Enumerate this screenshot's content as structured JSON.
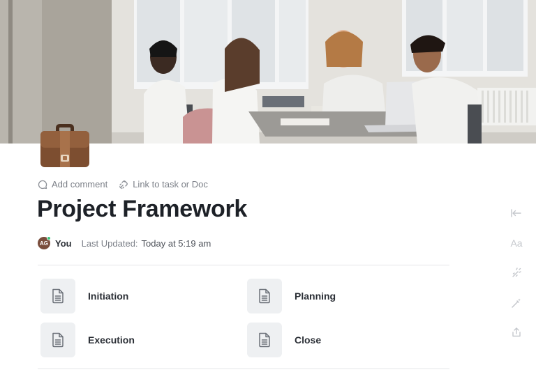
{
  "page": {
    "icon": "briefcase-icon",
    "cover": "team-meeting-photo",
    "actions": [
      {
        "label": "Add comment",
        "icon": "comment-icon"
      },
      {
        "label": "Link to task or Doc",
        "icon": "link-icon"
      }
    ],
    "title": "Project Framework",
    "author": {
      "initials": "AG",
      "name": "You",
      "online": true
    },
    "last_updated_label": "Last Updated:",
    "last_updated_value": "Today at 5:19 am"
  },
  "subpages": [
    {
      "label": "Initiation",
      "icon": "document-icon"
    },
    {
      "label": "Planning",
      "icon": "document-icon"
    },
    {
      "label": "Execution",
      "icon": "document-icon"
    },
    {
      "label": "Close",
      "icon": "document-icon"
    }
  ],
  "right_rail": {
    "items": [
      "collapse-icon",
      "typography-icon",
      "magic-icon",
      "wand-icon",
      "share-icon"
    ],
    "typography_label": "Aa"
  },
  "colors": {
    "title": "#1d2127",
    "muted_text": "#7c8088",
    "icon_tile": "#eef0f2",
    "divider": "#e4e5e8",
    "avatar": "#7a4d3c",
    "online": "#3cc47c",
    "rail_icon": "#c4c7cc"
  }
}
